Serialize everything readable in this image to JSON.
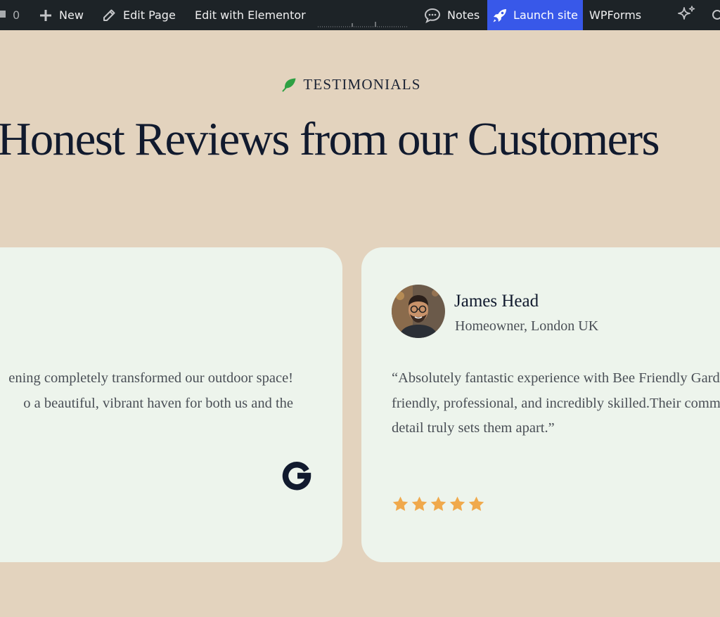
{
  "admin_bar": {
    "comments_count": "0",
    "new_label": "New",
    "edit_page_label": "Edit Page",
    "edit_elementor_label": "Edit with Elementor",
    "notes_label": "Notes",
    "launch_label": "Launch site",
    "wpforms_label": "WPForms"
  },
  "section": {
    "eyebrow": "TESTIMONIALS",
    "headline": "Honest Reviews from our Customers"
  },
  "cards": [
    {
      "quote_lines": [
        "ening completely transformed our outdoor space!",
        "o a beautiful, vibrant haven for both us and the"
      ],
      "source_icon": "google-icon"
    },
    {
      "name": "James Head",
      "role": "Homeowner, London UK",
      "quote_lines": [
        "“Absolutely fantastic experience with Bee Friendly Gard",
        "friendly, professional, and incredibly skilled.Their comm",
        "detail truly sets them apart.”"
      ],
      "rating": 5,
      "rating_max": 5
    }
  ],
  "colors": {
    "page_bg": "#e3d3be",
    "card_bg": "#edf4ec",
    "heading": "#111a2e",
    "admin_bar_bg": "#1d2327",
    "launch_bg": "#3858e9",
    "leaf": "#2ea043",
    "star": "#f0a94c"
  },
  "icons": [
    "comment-icon",
    "plus-icon",
    "pencil-icon",
    "notes-icon",
    "rocket-icon",
    "sparkle-icon",
    "search-icon",
    "leaf-icon",
    "google-icon",
    "star-icon"
  ]
}
